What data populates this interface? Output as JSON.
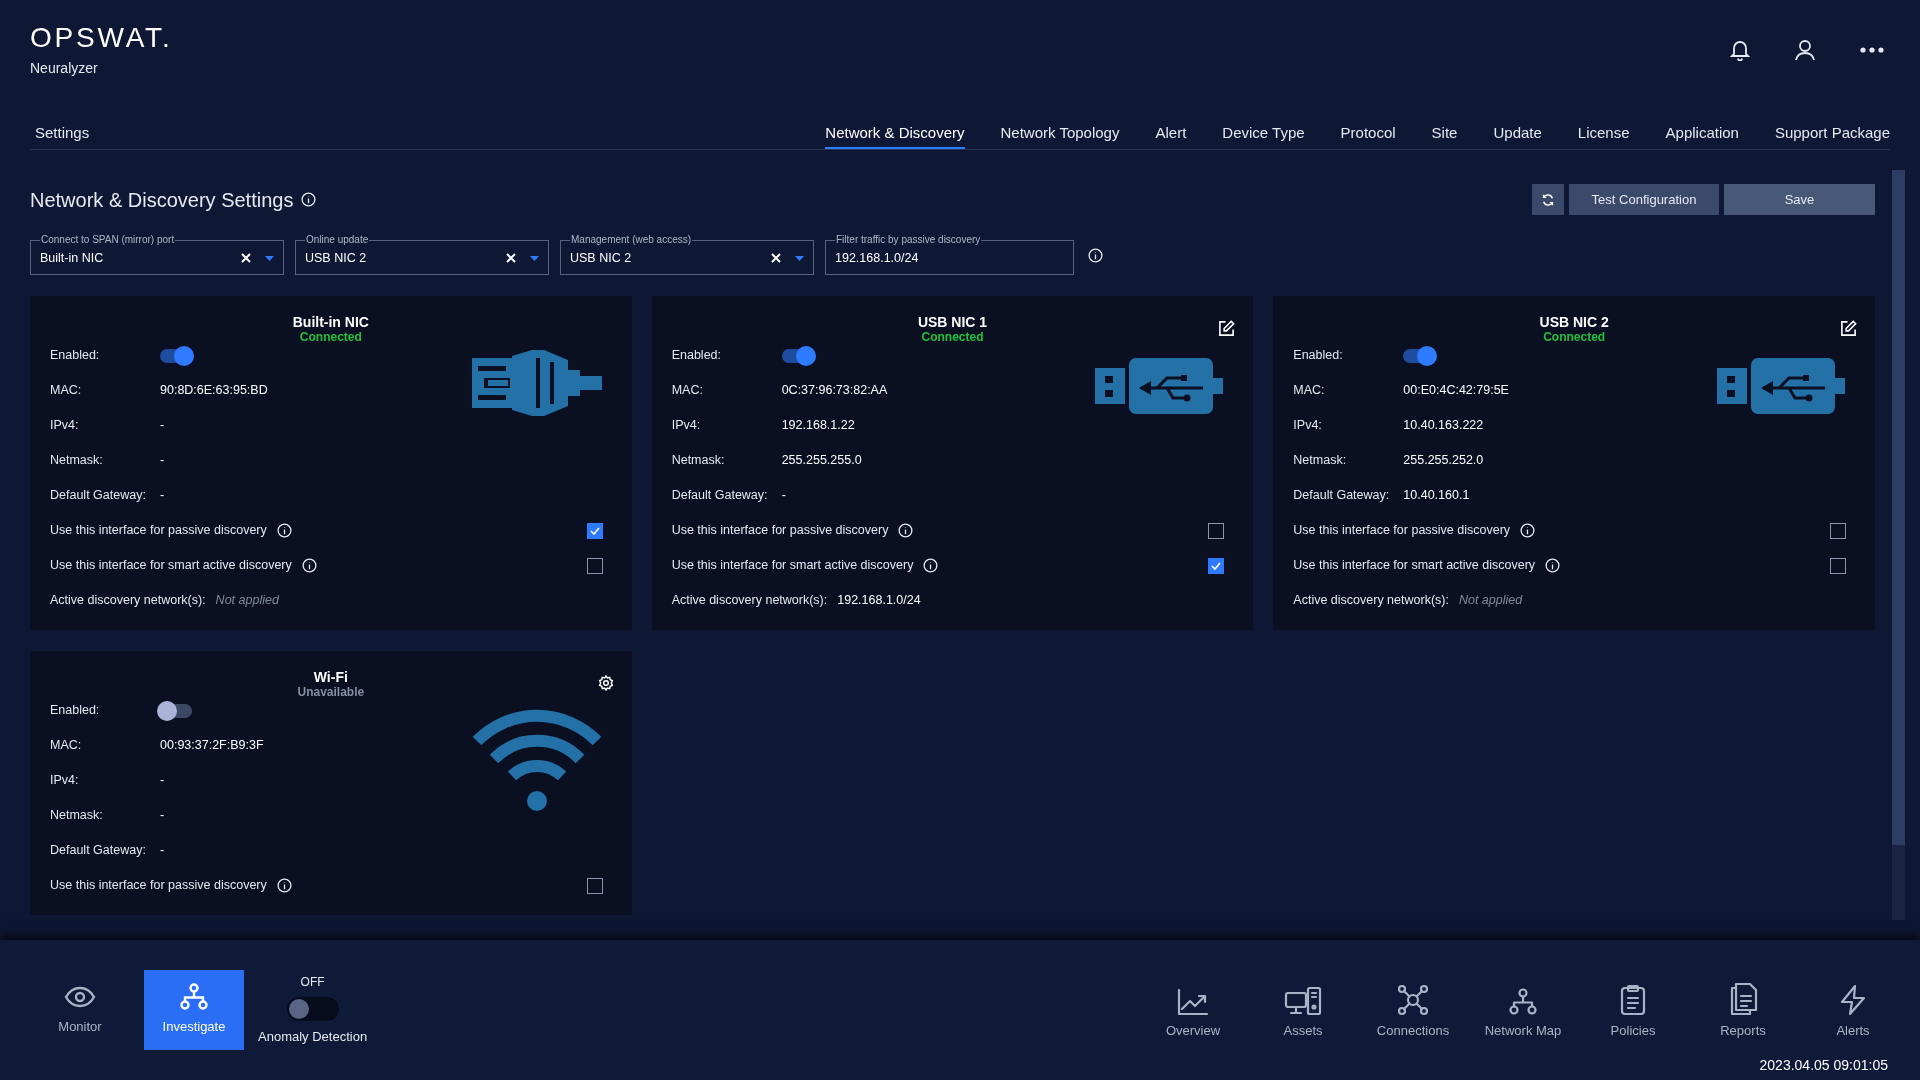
{
  "header": {
    "logo": "OPSWAT.",
    "product": "Neuralyzer"
  },
  "nav": {
    "section": "Settings",
    "tabs": [
      {
        "label": "Network & Discovery",
        "selected": true
      },
      {
        "label": "Network Topology",
        "selected": false
      },
      {
        "label": "Alert",
        "selected": false
      },
      {
        "label": "Device Type",
        "selected": false
      },
      {
        "label": "Protocol",
        "selected": false
      },
      {
        "label": "Site",
        "selected": false
      },
      {
        "label": "Update",
        "selected": false
      },
      {
        "label": "License",
        "selected": false
      },
      {
        "label": "Application",
        "selected": false
      },
      {
        "label": "Support Package",
        "selected": false
      }
    ]
  },
  "page": {
    "title": "Network & Discovery Settings",
    "buttons": [
      "Test Configuration",
      "Save"
    ]
  },
  "filters": [
    {
      "kind": "select",
      "label": "Connect to SPAN (mirror) port",
      "value": "Built-in NIC"
    },
    {
      "kind": "select",
      "label": "Online update",
      "value": "USB NIC 2"
    },
    {
      "kind": "select",
      "label": "Management (web access)",
      "value": "USB NIC 2"
    },
    {
      "kind": "text",
      "label": "Filter traffic by passive discovery",
      "value": "192.168.1.0/24"
    }
  ],
  "interfaces": [
    {
      "name": "Built-in NIC",
      "status": "Connected",
      "connected": true,
      "kind": "ethernet",
      "edit_button": false,
      "settings_button": false,
      "enabled": {
        "label": "Enabled:",
        "on": true
      },
      "rows": [
        {
          "label": "MAC:",
          "value": "90:8D:6E:63:95:BD"
        },
        {
          "label": "IPv4:",
          "value": "-"
        },
        {
          "label": "Netmask:",
          "value": "-"
        },
        {
          "label": "Default Gateway:",
          "value": "-"
        }
      ],
      "options": [
        {
          "label": "Use this interface for passive discovery",
          "checked": true
        },
        {
          "label": "Use this interface for smart active discovery",
          "checked": false
        }
      ],
      "active_networks": {
        "label": "Active discovery network(s):",
        "value": "Not applied",
        "applied": false
      }
    },
    {
      "name": "USB NIC 1",
      "status": "Connected",
      "connected": true,
      "kind": "usb",
      "edit_button": true,
      "settings_button": false,
      "enabled": {
        "label": "Enabled:",
        "on": true
      },
      "rows": [
        {
          "label": "MAC:",
          "value": "0C:37:96:73:82:AA"
        },
        {
          "label": "IPv4:",
          "value": "192.168.1.22"
        },
        {
          "label": "Netmask:",
          "value": "255.255.255.0"
        },
        {
          "label": "Default Gateway:",
          "value": "-"
        }
      ],
      "options": [
        {
          "label": "Use this interface for passive discovery",
          "checked": false
        },
        {
          "label": "Use this interface for smart active discovery",
          "checked": true
        }
      ],
      "active_networks": {
        "label": "Active discovery network(s):",
        "value": "192.168.1.0/24",
        "applied": true
      }
    },
    {
      "name": "USB NIC 2",
      "status": "Connected",
      "connected": true,
      "kind": "usb",
      "edit_button": true,
      "settings_button": false,
      "enabled": {
        "label": "Enabled:",
        "on": true
      },
      "rows": [
        {
          "label": "MAC:",
          "value": "00:E0:4C:42:79:5E"
        },
        {
          "label": "IPv4:",
          "value": "10.40.163.222"
        },
        {
          "label": "Netmask:",
          "value": "255.255.252.0"
        },
        {
          "label": "Default Gateway:",
          "value": "10.40.160.1"
        }
      ],
      "options": [
        {
          "label": "Use this interface for passive discovery",
          "checked": false
        },
        {
          "label": "Use this interface for smart active discovery",
          "checked": false
        }
      ],
      "active_networks": {
        "label": "Active discovery network(s):",
        "value": "Not applied",
        "applied": false
      }
    },
    {
      "name": "Wi-Fi",
      "status": "Unavailable",
      "connected": false,
      "kind": "wifi",
      "edit_button": false,
      "settings_button": true,
      "enabled": {
        "label": "Enabled:",
        "on": false
      },
      "rows": [
        {
          "label": "MAC:",
          "value": "00:93:37:2F:B9:3F"
        },
        {
          "label": "IPv4:",
          "value": "-"
        },
        {
          "label": "Netmask:",
          "value": "-"
        },
        {
          "label": "Default Gateway:",
          "value": "-"
        }
      ],
      "options": [
        {
          "label": "Use this interface for passive discovery",
          "checked": false
        }
      ]
    }
  ],
  "bottom_bar": {
    "modes": [
      {
        "label": "Monitor",
        "selected": false
      },
      {
        "label": "Investigate",
        "selected": true
      }
    ],
    "anomaly": {
      "state": "OFF",
      "label": "Anomaly Detection",
      "on": false
    },
    "items": [
      {
        "label": "Overview"
      },
      {
        "label": "Assets"
      },
      {
        "label": "Connections"
      },
      {
        "label": "Network Map"
      },
      {
        "label": "Policies"
      },
      {
        "label": "Reports"
      },
      {
        "label": "Alerts"
      }
    ],
    "timestamp": "2023.04.05 09:01:05"
  }
}
